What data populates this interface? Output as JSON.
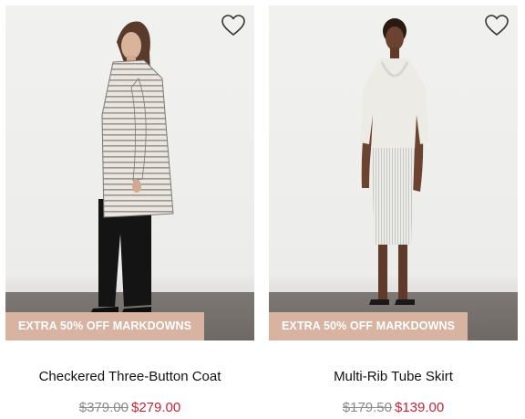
{
  "products": [
    {
      "badge": "EXTRA 50% OFF MARKDOWNS",
      "name": "Checkered Three-Button Coat",
      "original_price": "$379.00",
      "sale_price": "$279.00",
      "wishlist_icon": "heart-outline-icon"
    },
    {
      "badge": "EXTRA 50% OFF MARKDOWNS",
      "name": "Multi-Rib Tube Skirt",
      "original_price": "$179.50",
      "sale_price": "$139.00",
      "wishlist_icon": "heart-outline-icon"
    }
  ],
  "colors": {
    "badge_bg": "#d9b3a2",
    "sale_price": "#c3263a",
    "original_price": "#8a8a8a"
  }
}
